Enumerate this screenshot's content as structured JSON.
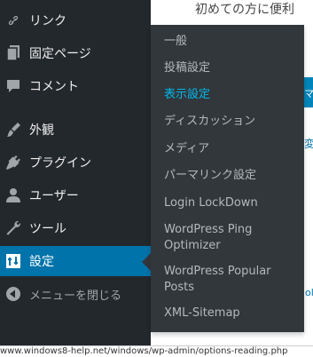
{
  "page": {
    "content_heading": "初めての方に便利",
    "right_button_fragment": "マ",
    "right_link_fragment": "変",
    "right_link_fragment2": "oli"
  },
  "sidebar": {
    "items": [
      {
        "label": "リンク",
        "icon": "link-icon"
      },
      {
        "label": "固定ページ",
        "icon": "pages-icon"
      },
      {
        "label": "コメント",
        "icon": "comments-icon"
      },
      {
        "label": "外観",
        "icon": "appearance-icon"
      },
      {
        "label": "プラグイン",
        "icon": "plugins-icon"
      },
      {
        "label": "ユーザー",
        "icon": "users-icon"
      },
      {
        "label": "ツール",
        "icon": "tools-icon"
      },
      {
        "label": "設定",
        "icon": "settings-icon",
        "active": true
      }
    ],
    "collapse_label": "メニューを閉じる",
    "collapse_icon": "collapse-icon"
  },
  "flyout": {
    "items": [
      {
        "label": "一般"
      },
      {
        "label": "投稿設定"
      },
      {
        "label": "表示設定",
        "current": true
      },
      {
        "label": "ディスカッション"
      },
      {
        "label": "メディア"
      },
      {
        "label": "パーマリンク設定"
      },
      {
        "label": "Login LockDown"
      },
      {
        "label": "WordPress Ping Optimizer"
      },
      {
        "label": "WordPress Popular Posts"
      },
      {
        "label": "XML-Sitemap"
      }
    ]
  },
  "statusbar": {
    "url": "www.windows8-help.net/windows/wp-admin/options-reading.php"
  },
  "colors": {
    "sidebar_bg": "#23282d",
    "flyout_bg": "#32373c",
    "active_bg": "#0073aa",
    "current_link": "#00b9eb"
  }
}
